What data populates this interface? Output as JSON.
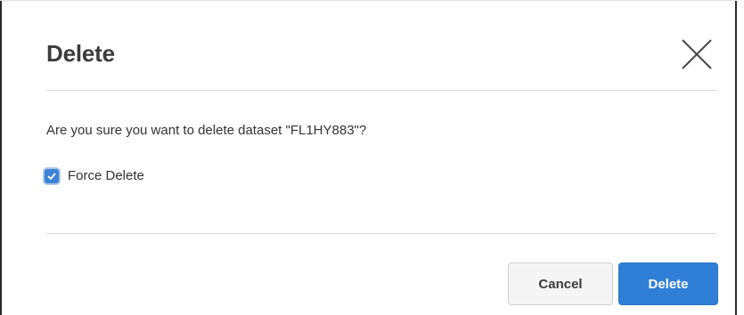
{
  "dialog": {
    "title": "Delete",
    "close_icon": "close-icon",
    "message": "Are you sure you want to delete dataset \"FL1HY883\"?",
    "force_delete": {
      "label": "Force Delete",
      "checked": true,
      "icon": "checkmark-icon"
    },
    "buttons": {
      "cancel_label": "Cancel",
      "delete_label": "Delete"
    }
  },
  "colors": {
    "primary": "#2f7fd6",
    "title_text": "#3b3b3b",
    "body_text": "#333333",
    "divider": "#d9d9d9"
  }
}
